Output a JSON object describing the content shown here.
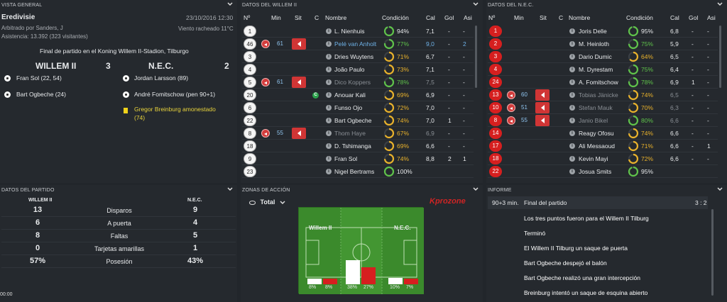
{
  "overview": {
    "title": "VISTA GENERAL",
    "competition": "Eredivisie",
    "date": "23/10/2016 12:30",
    "referee": "Arbitrado por Sanders, J",
    "weather": "Viento racheado 11°C",
    "attendance": "Asistencia: 13.392 (323 visitantes)",
    "final_text": "Final de partido en el Koning Willem II-Stadion, Tilburgo",
    "home_team": "WILLEM II",
    "home_score": "3",
    "away_team": "N.E.C.",
    "away_score": "2",
    "home_events": [
      "Fran Sol (22, 54)",
      "Bart Ogbeche (24)"
    ],
    "away_events": [
      "Jordan Larsson (89)",
      "André Fomitschow (pen 90+1)"
    ],
    "card_event": "Gregor Breinburg amonestado (74)"
  },
  "home_lineup": {
    "title": "DATOS DEL WILLEM II",
    "headers": {
      "no": "Nº",
      "min": "Min",
      "sit": "Sit",
      "c": "C",
      "name": "Nombre",
      "cond": "Condición",
      "cal": "Cal",
      "gol": "Gol",
      "asi": "Asi"
    },
    "rows": [
      {
        "no": "1",
        "name": "L. Nienhuis",
        "cond": "94%",
        "cal": "7,1",
        "gol": "-",
        "asi": "-"
      },
      {
        "no": "46",
        "min": "61",
        "name": "Pelé van Anholt",
        "cond": "77%",
        "cal": "9,0",
        "gol": "-",
        "asi": "2"
      },
      {
        "no": "3",
        "name": "Dries Wuytens",
        "cond": "71%",
        "cal": "6,7",
        "gol": "-",
        "asi": "-"
      },
      {
        "no": "4",
        "name": "João Paulo",
        "cond": "73%",
        "cal": "7,1",
        "gol": "-",
        "asi": "-"
      },
      {
        "no": "5",
        "min": "61",
        "name": "Dico Koppers",
        "cond": "78%",
        "cal": "7,5",
        "gol": "-",
        "asi": "-"
      },
      {
        "no": "20",
        "cap": "C",
        "name": "Anouar Kali",
        "cond": "69%",
        "cal": "6,9",
        "gol": "-",
        "asi": "-"
      },
      {
        "no": "6",
        "name": "Funso Ojo",
        "cond": "72%",
        "cal": "7,0",
        "gol": "-",
        "asi": "-"
      },
      {
        "no": "22",
        "name": "Bart Ogbeche",
        "cond": "74%",
        "cal": "7,0",
        "gol": "1",
        "asi": "-"
      },
      {
        "no": "8",
        "min": "55",
        "name": "Thom Haye",
        "cond": "67%",
        "cal": "6,9",
        "gol": "-",
        "asi": "-"
      },
      {
        "no": "18",
        "name": "D. Tshimanga",
        "cond": "69%",
        "cal": "6,6",
        "gol": "-",
        "asi": "-"
      },
      {
        "no": "9",
        "name": "Fran Sol",
        "cond": "74%",
        "cal": "8,8",
        "gol": "2",
        "asi": "1"
      },
      {
        "no": "23",
        "name": "Nigel Bertrams",
        "cond": "100%",
        "cal": "",
        "gol": "",
        "asi": ""
      }
    ]
  },
  "away_lineup": {
    "title": "DATOS DEL N.E.C.",
    "rows": [
      {
        "no": "1",
        "name": "Joris Delle",
        "cond": "95%",
        "cal": "6,8",
        "gol": "-",
        "asi": "-"
      },
      {
        "no": "2",
        "name": "M. Heinloth",
        "cond": "75%",
        "cal": "5,9",
        "gol": "-",
        "asi": "-"
      },
      {
        "no": "3",
        "name": "Dario Dumic",
        "cond": "64%",
        "cal": "6,5",
        "gol": "-",
        "asi": "-"
      },
      {
        "no": "4",
        "name": "M. Dyrestam",
        "cond": "75%",
        "cal": "6,4",
        "gol": "-",
        "asi": "-"
      },
      {
        "no": "24",
        "name": "A. Fomitschow",
        "cond": "78%",
        "cal": "6,9",
        "gol": "1",
        "asi": "-"
      },
      {
        "no": "13",
        "min": "60",
        "name": "Tobias Jänicke",
        "cond": "74%",
        "cal": "6,5",
        "gol": "-",
        "asi": "-"
      },
      {
        "no": "10",
        "min": "51",
        "name": "Stefan Mauk",
        "cond": "70%",
        "cal": "6,3",
        "gol": "-",
        "asi": "-"
      },
      {
        "no": "8",
        "min": "55",
        "name": "Janio Bikel",
        "cond": "80%",
        "cal": "6,6",
        "gol": "-",
        "asi": "-"
      },
      {
        "no": "14",
        "name": "Reagy Ofosu",
        "cond": "74%",
        "cal": "6,6",
        "gol": "-",
        "asi": "-"
      },
      {
        "no": "17",
        "name": "Ali Messaoud",
        "cond": "71%",
        "cal": "6,6",
        "gol": "-",
        "asi": "1"
      },
      {
        "no": "18",
        "name": "Kevin Mayi",
        "cond": "72%",
        "cal": "6,6",
        "gol": "-",
        "asi": "-"
      },
      {
        "no": "22",
        "name": "Josua Smits",
        "cond": "95%",
        "cal": "",
        "gol": "",
        "asi": ""
      }
    ]
  },
  "stats": {
    "title": "DATOS DEL PARTIDO",
    "home": "WILLEM II",
    "away": "N.E.C.",
    "rows": [
      {
        "label": "Disparos",
        "home": "13",
        "away": "9"
      },
      {
        "label": "A puerta",
        "home": "6",
        "away": "4"
      },
      {
        "label": "Faltas",
        "home": "8",
        "away": "5"
      },
      {
        "label": "Tarjetas amarillas",
        "home": "0",
        "away": "1"
      },
      {
        "label": "Posesión",
        "home": "57%",
        "away": "43%"
      }
    ],
    "clock": "00:00"
  },
  "zones": {
    "title": "ZONAS DE ACCIÓN",
    "filter": "Total",
    "brand": "Kprozone",
    "home": "Willem II",
    "away": "N.E.C.",
    "bars": [
      {
        "home": 8,
        "away": 8,
        "home_label": "8%",
        "away_label": "8%"
      },
      {
        "home": 38,
        "away": 27,
        "home_label": "38%",
        "away_label": "27%"
      },
      {
        "home": 10,
        "away": 7,
        "home_label": "10%",
        "away_label": "7%"
      }
    ]
  },
  "report": {
    "title": "INFORME",
    "time": "90+3 min.",
    "headline": "Final del partido",
    "score": "3 : 2",
    "lines": [
      "Los tres puntos fueron para el Willem II Tilburg",
      "Terminó",
      "El Willem II Tilburg un saque de puerta",
      "Bart Ogbeche despejó el balón",
      "Bart Ogbeche realizó una gran intercepción",
      "Breinburg intentó un saque de esquina abierto"
    ]
  },
  "colors": {
    "green": "#5fc24a",
    "yellow": "#e8b12b",
    "red": "#d61f1f"
  }
}
